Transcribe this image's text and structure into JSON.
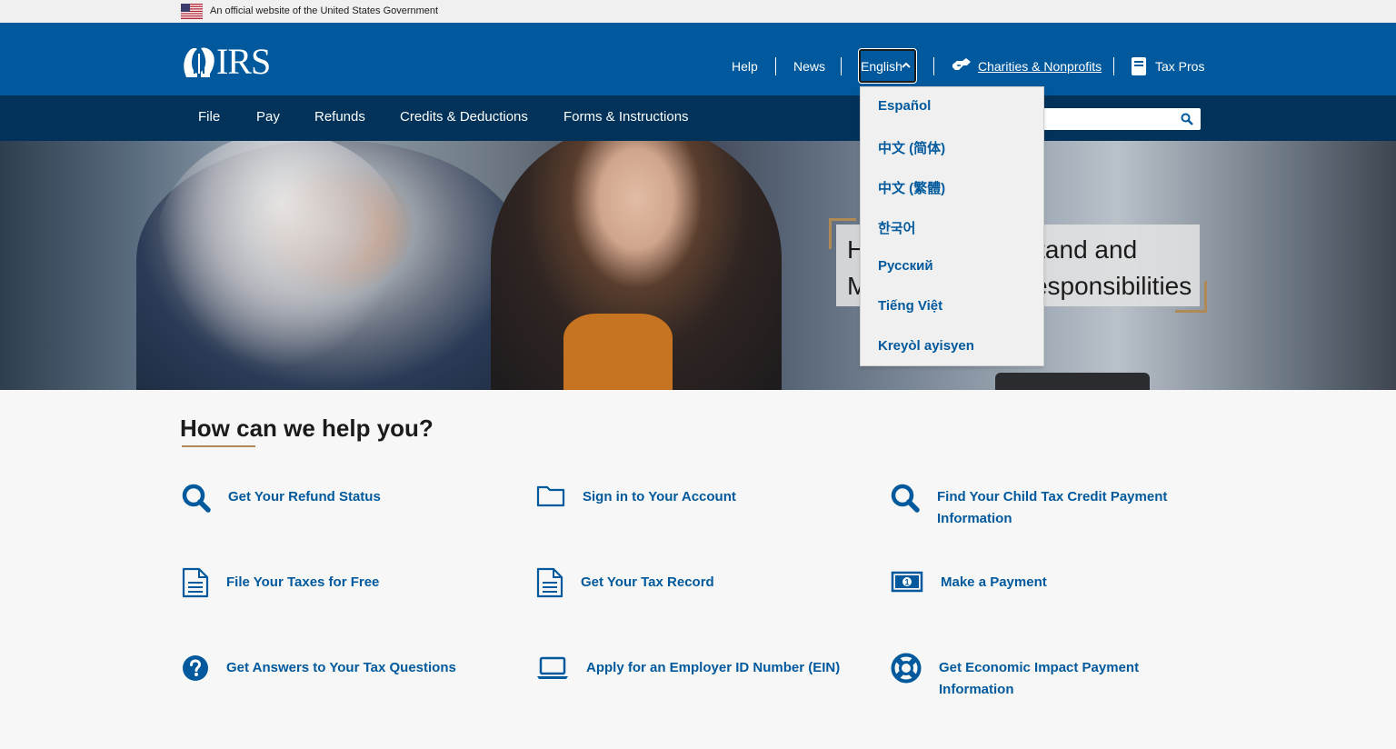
{
  "gov_banner": {
    "text": "An official website of the United States Government"
  },
  "header": {
    "logo_text": "IRS",
    "links": {
      "help": "Help",
      "news": "News",
      "charities": "Charities & Nonprofits",
      "tax_pros": "Tax Pros"
    },
    "language_button": "English"
  },
  "nav": {
    "items": [
      "File",
      "Pay",
      "Refunds",
      "Credits & Deductions",
      "Forms & Instructions"
    ]
  },
  "language_menu": {
    "items": [
      "Español",
      "中文 (简体)",
      "中文 (繁體)",
      "한국어",
      "Русский",
      "Tiếng Việt",
      "Kreyòl ayisyen"
    ]
  },
  "hero": {
    "caption": "Help You Understand and Meet Your Tax Responsibilities"
  },
  "help": {
    "title": "How can we help you?",
    "tasks": [
      {
        "label": "Get Your Refund Status",
        "icon": "search-icon"
      },
      {
        "label": "Sign in to Your Account",
        "icon": "folder-icon"
      },
      {
        "label": "Find Your Child Tax Credit Payment Information",
        "icon": "search-icon"
      },
      {
        "label": "File Your Taxes for Free",
        "icon": "document-icon"
      },
      {
        "label": "Get Your Tax Record",
        "icon": "document-icon"
      },
      {
        "label": "Make a Payment",
        "icon": "money-icon"
      },
      {
        "label": "Get Answers to Your Tax Questions",
        "icon": "question-icon"
      },
      {
        "label": "Apply for an Employer ID Number (EIN)",
        "icon": "laptop-icon"
      },
      {
        "label": "Get Economic Impact Payment Information",
        "icon": "lifesaver-icon"
      }
    ]
  },
  "colors": {
    "primary_blue": "#00599c",
    "nav_blue": "#00325a",
    "accent_gold": "#b08a56"
  }
}
